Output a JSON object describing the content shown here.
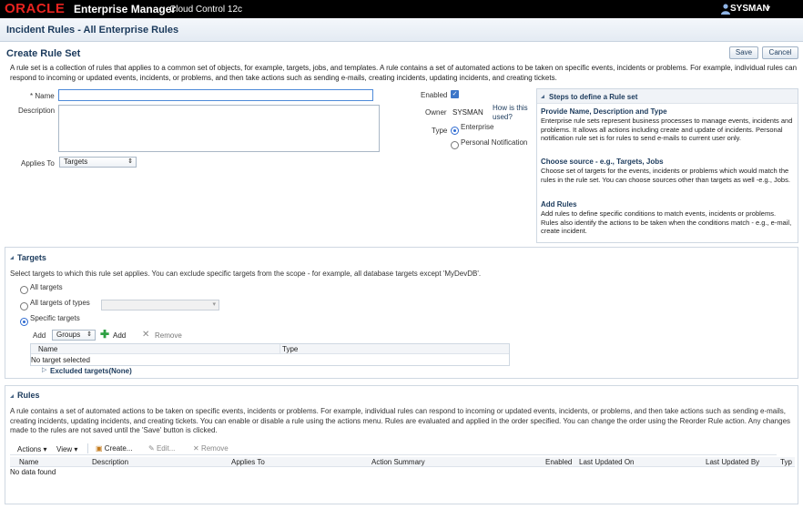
{
  "header": {
    "logo": "ORACLE",
    "product": "Enterprise Manager",
    "product_sub": "Cloud Control 12c",
    "user": "SYSMAN"
  },
  "page": {
    "title": "Incident Rules - All Enterprise Rules",
    "form_title": "Create Rule Set",
    "save_label": "Save",
    "cancel_label": "Cancel",
    "description": "A rule set is a collection of rules that applies to a common set of objects, for example, targets, jobs, and templates. A rule contains a set of automated actions to be taken on specific events, incidents or problems. For example, individual rules can respond to incoming or updated events, incidents, or problems, and then take actions such as sending e-mails, creating incidents, updating incidents, and creating tickets."
  },
  "form": {
    "name_label": "* Name",
    "name_value": "",
    "description_label": "Description",
    "applies_to_label": "Applies To",
    "applies_to_value": "Targets",
    "enabled_label": "Enabled",
    "enabled": true,
    "owner_label": "Owner",
    "owner_value": "SYSMAN",
    "how_used_link": "How is this used?",
    "type_label": "Type",
    "type_enterprise": "Enterprise",
    "type_personal": "Personal Notification"
  },
  "steps": {
    "title": "Steps to define a Rule set",
    "items": [
      {
        "heading": "Provide Name, Description and Type",
        "text": "Enterprise rule sets represent business processes to manage events, incidents and problems. It allows all actions including create and update of incidents. Personal notification rule set is for rules to send e-mails to current user only."
      },
      {
        "heading": "Choose source - e.g., Targets, Jobs",
        "text": "Choose set of targets for the events, incidents or problems which would match the rules in the rule set. You can choose sources other than targets as well -e.g., Jobs."
      },
      {
        "heading": "Add Rules",
        "text": "Add rules to define specific conditions to match events, incidents or problems. Rules also identify the actions to be taken when the conditions match - e.g., e-mail, create incident."
      }
    ]
  },
  "targets": {
    "title": "Targets",
    "description": "Select targets to which this rule set applies. You can exclude specific targets from the scope - for example, all database targets except 'MyDevDB'.",
    "opt_all": "All targets",
    "opt_types": "All targets of types",
    "opt_specific": "Specific targets",
    "add_label": "Add",
    "groups_value": "Groups",
    "add_button": "Add",
    "remove_button": "Remove",
    "col_name": "Name",
    "col_type": "Type",
    "empty": "No target selected",
    "excluded": "Excluded targets(None)"
  },
  "rules": {
    "title": "Rules",
    "description": "A rule contains a set of automated actions to be taken on specific events, incidents or problems. For example, individual rules can respond to incoming or updated events, incidents, or problems, and then take actions such as sending e-mails, creating incidents, updating incidents, and creating tickets. You can enable or disable a rule using the actions menu. Rules are evaluated and applied in the order specified. You can change the order using the Reorder Rule action. Any changes made to the rules are not saved until the 'Save' button is clicked.",
    "actions_menu": "Actions",
    "view_menu": "View",
    "create_button": "Create...",
    "edit_button": "Edit...",
    "remove_button": "Remove",
    "columns": [
      "Name",
      "Description",
      "Applies To",
      "Action Summary",
      "Enabled",
      "Last Updated On",
      "Last Updated By",
      "Typ"
    ],
    "empty": "No data found"
  },
  "colors": {
    "oracle_red": "#e8231f",
    "title_blue": "#1b3a5c",
    "add_green": "#2ea043"
  }
}
